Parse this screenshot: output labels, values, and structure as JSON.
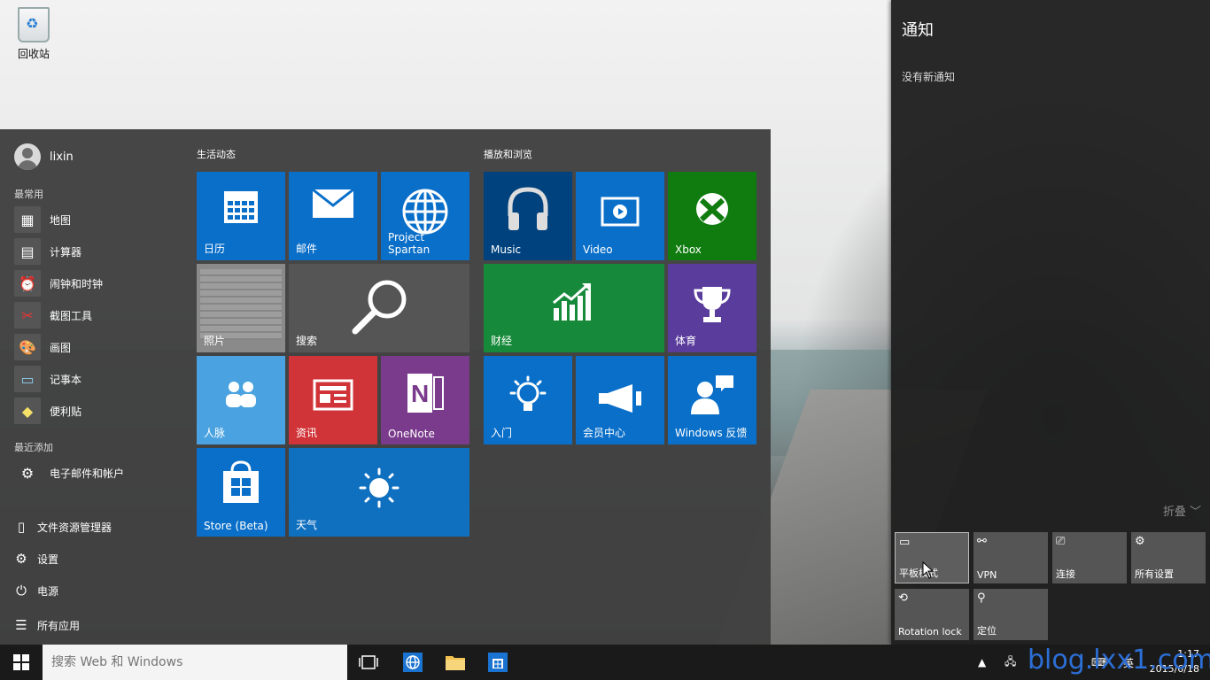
{
  "desktop": {
    "recycle_bin": "回收站"
  },
  "start_menu": {
    "user_name": "lixin",
    "most_used_label": "最常用",
    "most_used": [
      {
        "label": "地图",
        "icon": "map-icon"
      },
      {
        "label": "计算器",
        "icon": "calculator-icon"
      },
      {
        "label": "闹钟和时钟",
        "icon": "alarm-clock-icon"
      },
      {
        "label": "截图工具",
        "icon": "snipping-tool-icon"
      },
      {
        "label": "画图",
        "icon": "paint-icon"
      },
      {
        "label": "记事本",
        "icon": "notepad-icon"
      },
      {
        "label": "便利贴",
        "icon": "sticky-notes-icon"
      }
    ],
    "recently_added_label": "最近添加",
    "recently_added": [
      {
        "label": "电子邮件和帐户",
        "icon": "gear-icon"
      }
    ],
    "system": {
      "file_explorer": "文件资源管理器",
      "settings": "设置",
      "power": "电源",
      "all_apps": "所有应用"
    },
    "group_life": "生活动态",
    "group_play": "播放和浏览",
    "tiles": {
      "calendar": "日历",
      "mail": "邮件",
      "spartan": "Project Spartan",
      "photos": "照片",
      "search": "搜索",
      "people": "人脉",
      "news": "资讯",
      "onenote": "OneNote",
      "store": "Store (Beta)",
      "weather": "天气",
      "music": "Music",
      "video": "Video",
      "xbox": "Xbox",
      "finance": "财经",
      "sports": "体育",
      "getstarted": "入门",
      "insider": "会员中心",
      "feedback": "Windows 反馈"
    },
    "colors": {
      "blue": "#0a6fc9",
      "darkblue": "#00427e",
      "green": "#107c10",
      "finance_green": "#168a3a",
      "purple": "#5a3c9d",
      "lightblue": "#4aa3e0",
      "red": "#d13438",
      "onenote": "#7b3b8c",
      "gray": "#555555",
      "weather": "#1070c0"
    }
  },
  "action_center": {
    "title": "通知",
    "empty": "没有新通知",
    "collapse": "折叠",
    "quick_actions": [
      {
        "label": "平板模式",
        "icon": "tablet-mode-icon"
      },
      {
        "label": "VPN",
        "icon": "vpn-icon"
      },
      {
        "label": "连接",
        "icon": "connect-icon"
      },
      {
        "label": "所有设置",
        "icon": "settings-icon"
      },
      {
        "label": "Rotation lock",
        "icon": "rotation-lock-icon"
      },
      {
        "label": "定位",
        "icon": "location-icon"
      }
    ]
  },
  "taskbar": {
    "search_placeholder": "搜索 Web 和 Windows",
    "ime": "英",
    "time": "1:17",
    "date": "2015/6/18"
  },
  "watermark": "blog.lxx1.com"
}
